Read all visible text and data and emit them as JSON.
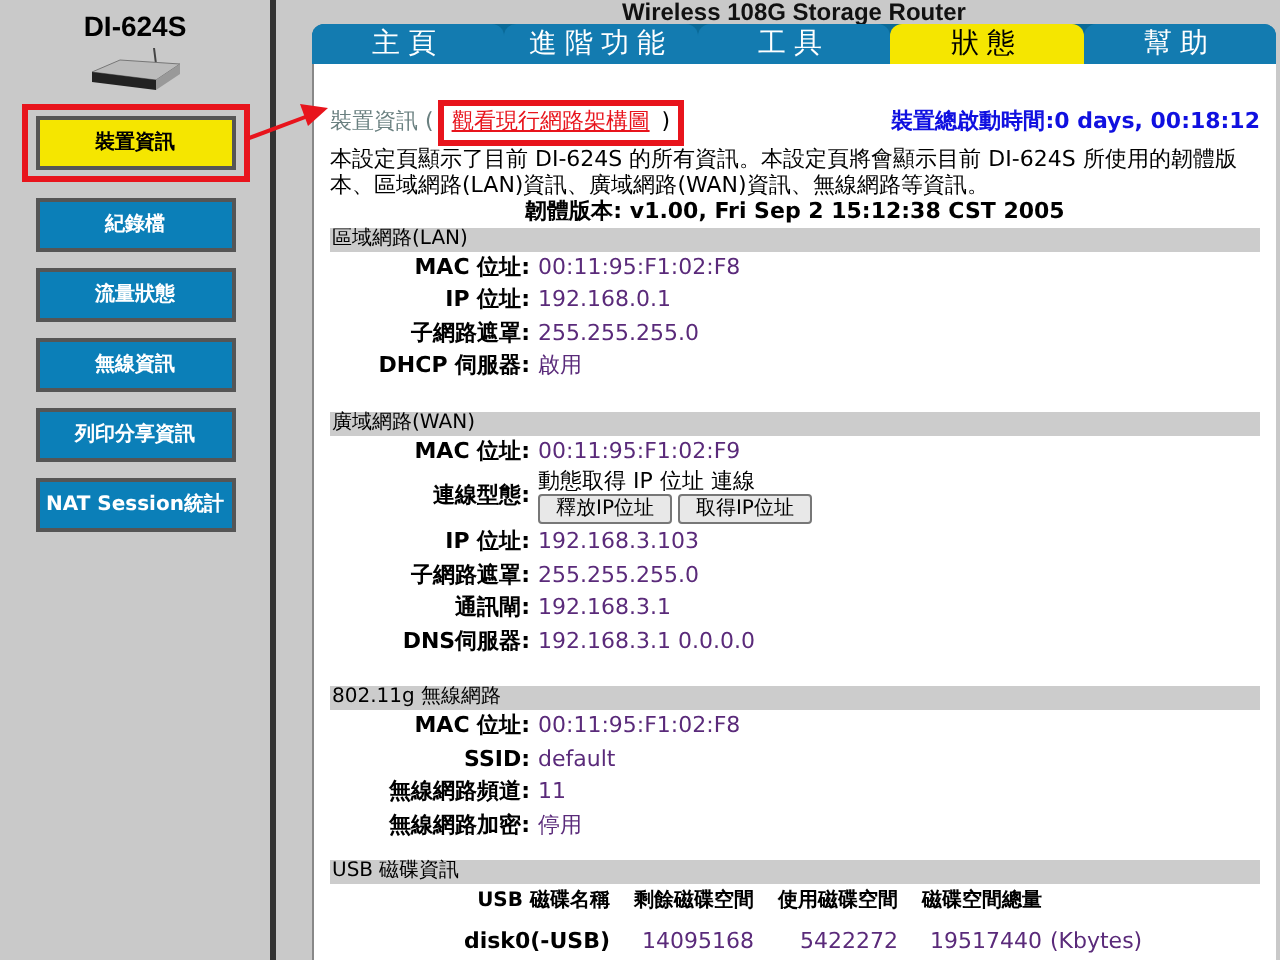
{
  "header": {
    "model": "DI-624S",
    "title": "Wireless 108G Storage Router"
  },
  "sidebar": {
    "items": [
      {
        "label": "裝置資訊",
        "selected": true
      },
      {
        "label": "紀錄檔",
        "selected": false
      },
      {
        "label": "流量狀態",
        "selected": false
      },
      {
        "label": "無線資訊",
        "selected": false
      },
      {
        "label": "列印分享資訊",
        "selected": false
      },
      {
        "label": "NAT Session統計",
        "selected": false
      }
    ]
  },
  "tabs": [
    {
      "label": "主頁",
      "selected": false
    },
    {
      "label": "進階功能",
      "selected": false
    },
    {
      "label": "工具",
      "selected": false
    },
    {
      "label": "狀態",
      "selected": true
    },
    {
      "label": "幫助",
      "selected": false
    }
  ],
  "device_info": {
    "heading": "裝置資訊 (",
    "link": "觀看現行網路架構圖",
    "link_close": ")",
    "uptime": "裝置總啟動時間:0 days, 00:18:12",
    "description": "本設定頁顯示了目前 DI-624S 的所有資訊。本設定頁將會顯示目前 DI-624S 所使用的韌體版本、區域網路(LAN)資訊、廣域網路(WAN)資訊、無線網路等資訊。",
    "firmware": "韌體版本: v1.00, Fri Sep 2 15:12:38 CST 2005"
  },
  "sections": [
    {
      "title": "區域網路(LAN)",
      "rows": [
        {
          "kind": "text",
          "label": "MAC 位址:",
          "value": "00:11:95:F1:02:F8"
        },
        {
          "kind": "text",
          "label": "IP 位址:",
          "value": "192.168.0.1"
        },
        {
          "kind": "text",
          "label": "子網路遮罩:",
          "value": "255.255.255.0"
        },
        {
          "kind": "text",
          "label": "DHCP 伺服器:",
          "value": "啟用"
        }
      ]
    },
    {
      "title": "廣域網路(WAN)",
      "rows": [
        {
          "kind": "text",
          "label": "MAC 位址:",
          "value": "00:11:95:F1:02:F9"
        },
        {
          "kind": "buttons",
          "label": "連線型態:",
          "value": "動態取得 IP 位址 連線",
          "buttons": [
            "釋放IP位址",
            "取得IP位址"
          ]
        },
        {
          "kind": "text",
          "label": "IP 位址:",
          "value": "192.168.3.103"
        },
        {
          "kind": "text",
          "label": "子網路遮罩:",
          "value": "255.255.255.0"
        },
        {
          "kind": "text",
          "label": "通訊閘:",
          "value": "192.168.3.1"
        },
        {
          "kind": "text",
          "label": "DNS伺服器:",
          "value": "192.168.3.1 0.0.0.0"
        }
      ]
    },
    {
      "title": "802.11g 無線網路",
      "rows": [
        {
          "kind": "text",
          "label": "MAC 位址:",
          "value": "00:11:95:F1:02:F8"
        },
        {
          "kind": "text",
          "label": "SSID:",
          "value": "default"
        },
        {
          "kind": "text",
          "label": "無線網路頻道:",
          "value": "11"
        },
        {
          "kind": "text",
          "label": "無線網路加密:",
          "value": "停用"
        }
      ]
    }
  ],
  "usb": {
    "title": "USB 磁碟資訊",
    "columns": [
      "USB 磁碟名稱",
      "剩餘磁碟空間",
      "使用磁碟空間",
      "磁碟空間總量"
    ],
    "rows": [
      {
        "cells": [
          "disk0(-USB)",
          "14095168",
          "5422272",
          "19517440"
        ],
        "unit": "(Kbytes)"
      }
    ]
  }
}
